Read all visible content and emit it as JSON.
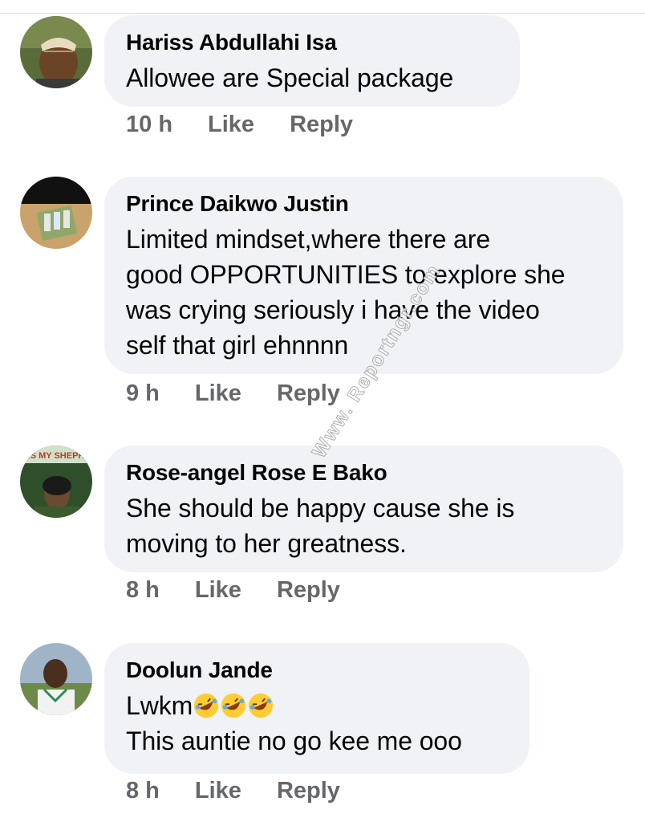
{
  "comments": [
    {
      "author": "Hariss Abdullahi Isa",
      "lines": [
        "Allowee are Special package"
      ],
      "time": "10 h",
      "like": "Like",
      "reply": "Reply"
    },
    {
      "author": "Prince Daikwo Justin",
      "lines": [
        "Limited mindset,where there are",
        "good OPPORTUNITIES to explore she",
        "was crying seriously i have the video",
        "self that girl ehnnnn"
      ],
      "time": "9 h",
      "like": "Like",
      "reply": "Reply"
    },
    {
      "author": "Rose-angel Rose E Bako",
      "lines": [
        "She should be happy cause she is",
        "moving to her greatness."
      ],
      "time": "8 h",
      "like": "Like",
      "reply": "Reply",
      "avatar_text": "IS MY SHEPH"
    },
    {
      "author": "Doolun Jande",
      "lines": [
        "Lwkm",
        "This auntie no go kee me ooo"
      ],
      "emoji": "rolling-on-floor-laughing-icon",
      "emoji_count": 3,
      "time": "8 h",
      "like": "Like",
      "reply": "Reply"
    }
  ],
  "watermark": "Www. Reportngr.com"
}
